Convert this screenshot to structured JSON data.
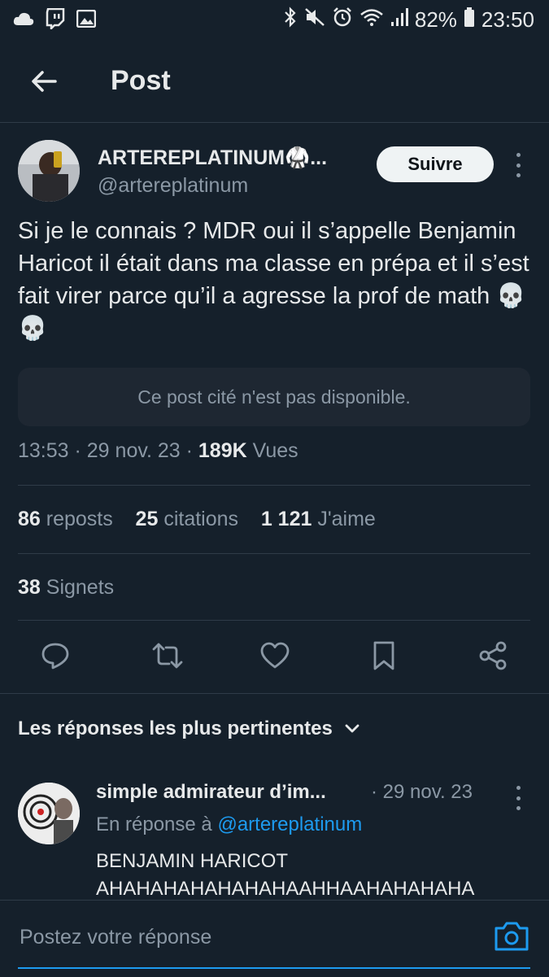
{
  "status_bar": {
    "battery": "82%",
    "time": "23:50",
    "left_icons": [
      "cloud-icon",
      "twitch-icon",
      "image-icon"
    ],
    "right_icons": [
      "bluetooth-icon",
      "mute-icon",
      "alarm-icon",
      "wifi-icon",
      "signal-icon",
      "battery-icon"
    ]
  },
  "header": {
    "title": "Post"
  },
  "tweet": {
    "author_name": "ARTEREPLATINUM🥋...",
    "author_handle": "@artereplatinum",
    "follow_label": "Suivre",
    "text": "Si je le connais ? MDR oui il s’appelle Benjamin Haricot il était dans ma classe en prépa et il s’est fait virer parce qu’il a agresse la prof de math 💀💀",
    "quote_unavailable": "Ce post cité n'est pas disponible.",
    "time": "13:53",
    "date": "29 nov. 23",
    "views_count": "189K",
    "views_label": "Vues",
    "reposts_count": "86",
    "reposts_label": "reposts",
    "quotes_count": "25",
    "quotes_label": "citations",
    "likes_count": "1 121",
    "likes_label": "J'aime",
    "bookmarks_count": "38",
    "bookmarks_label": "Signets"
  },
  "actions": [
    "reply-icon",
    "repost-icon",
    "like-icon",
    "bookmark-icon",
    "share-icon"
  ],
  "replies": {
    "sort_label": "Les réponses les plus pertinentes",
    "items": [
      {
        "name": "simple admirateur d’im...",
        "date": "· 29 nov. 23",
        "reply_to_prefix": "En réponse à",
        "reply_to_handle": "@artereplatinum",
        "text_line1": "BENJAMIN HARICOT",
        "text_line2": "AHAHAHAHAHAHAHAAHHAAHAHAHAHA"
      }
    ]
  },
  "composer": {
    "placeholder": "Postez votre réponse"
  },
  "colors": {
    "background": "#15202b",
    "accent": "#1d9bf0",
    "muted": "#8b98a5"
  }
}
